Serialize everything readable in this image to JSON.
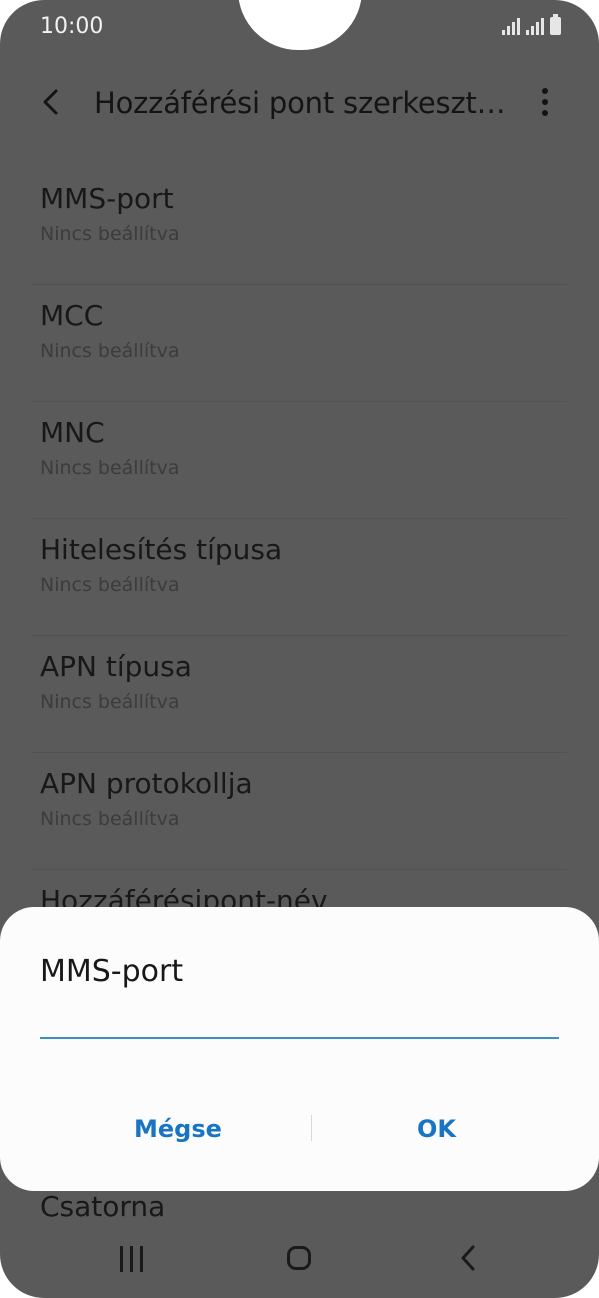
{
  "status_bar": {
    "time": "10:00"
  },
  "app_bar": {
    "title": "Hozzáférési pont szerkesztése"
  },
  "list": {
    "items": [
      {
        "title": "MMS-port",
        "subtitle": "Nincs beállítva"
      },
      {
        "title": "MCC",
        "subtitle": "Nincs beállítva"
      },
      {
        "title": "MNC",
        "subtitle": "Nincs beállítva"
      },
      {
        "title": "Hitelesítés típusa",
        "subtitle": "Nincs beállítva"
      },
      {
        "title": "APN típusa",
        "subtitle": "Nincs beállítva"
      },
      {
        "title": "APN protokollja",
        "subtitle": "Nincs beállítva"
      },
      {
        "title": "Hozzáférésipont-név",
        "subtitle": ""
      }
    ],
    "bottom_item": "Csatorna"
  },
  "dialog": {
    "title": "MMS-port",
    "input_value": "",
    "cancel_label": "Mégse",
    "ok_label": "OK"
  },
  "colors": {
    "accent": "#1a74c4",
    "input_underline": "#3e8fc4",
    "scrim": "#5a5a5a"
  },
  "icons": {
    "back": "chevron-left-icon",
    "more": "more-vertical-icon",
    "nav_recents": "recents-icon",
    "nav_home": "home-icon",
    "nav_back": "nav-back-icon"
  }
}
